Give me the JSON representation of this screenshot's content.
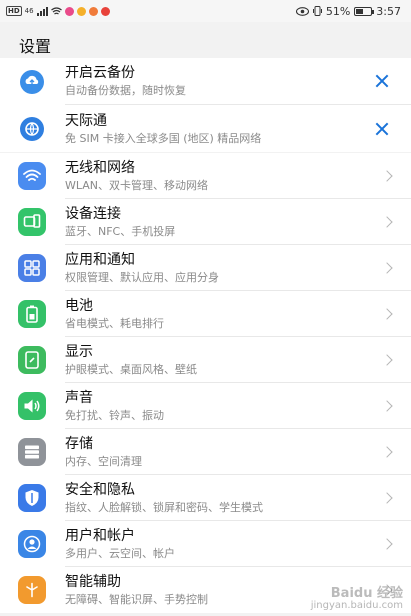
{
  "status_bar": {
    "left_badge": "HD",
    "network": "46",
    "battery_percent": "51%",
    "battery_level": 0.51,
    "time": "3:57"
  },
  "page": {
    "title": "设置"
  },
  "top_items": [
    {
      "title": "开启云备份",
      "subtitle": "自动备份数据，随时恢复",
      "icon": "cloud-backup-icon",
      "color": "#3a8ee8"
    },
    {
      "title": "天际通",
      "subtitle": "免 SIM 卡接入全球多国 (地区) 精品网络",
      "icon": "skytone-icon",
      "color": "#2f7fe0"
    }
  ],
  "items": [
    {
      "title": "无线和网络",
      "subtitle": "WLAN、双卡管理、移动网络",
      "icon": "wifi-icon",
      "color": "#4a8cf0"
    },
    {
      "title": "设备连接",
      "subtitle": "蓝牙、NFC、手机投屏",
      "icon": "device-connection-icon",
      "color": "#33c46a"
    },
    {
      "title": "应用和通知",
      "subtitle": "权限管理、默认应用、应用分身",
      "icon": "apps-icon",
      "color": "#4a7fe6"
    },
    {
      "title": "电池",
      "subtitle": "省电模式、耗电排行",
      "icon": "battery-icon",
      "color": "#34c168"
    },
    {
      "title": "显示",
      "subtitle": "护眼模式、桌面风格、壁纸",
      "icon": "display-icon",
      "color": "#3dbb5e"
    },
    {
      "title": "声音",
      "subtitle": "免打扰、铃声、振动",
      "icon": "sound-icon",
      "color": "#34c168"
    },
    {
      "title": "存储",
      "subtitle": "内存、空间清理",
      "icon": "storage-icon",
      "color": "#8f9399"
    },
    {
      "title": "安全和隐私",
      "subtitle": "指纹、人脸解锁、锁屏和密码、学生模式",
      "icon": "shield-icon",
      "color": "#3a7ae8"
    },
    {
      "title": "用户和帐户",
      "subtitle": "多用户、云空间、帐户",
      "icon": "user-icon",
      "color": "#3a86e6"
    },
    {
      "title": "智能辅助",
      "subtitle": "无障碍、智能识屏、手势控制",
      "icon": "assistant-icon",
      "color": "#f29a2e"
    }
  ],
  "watermark": {
    "line1": "Baidu 经验",
    "line2": "jingyan.baidu.com"
  }
}
